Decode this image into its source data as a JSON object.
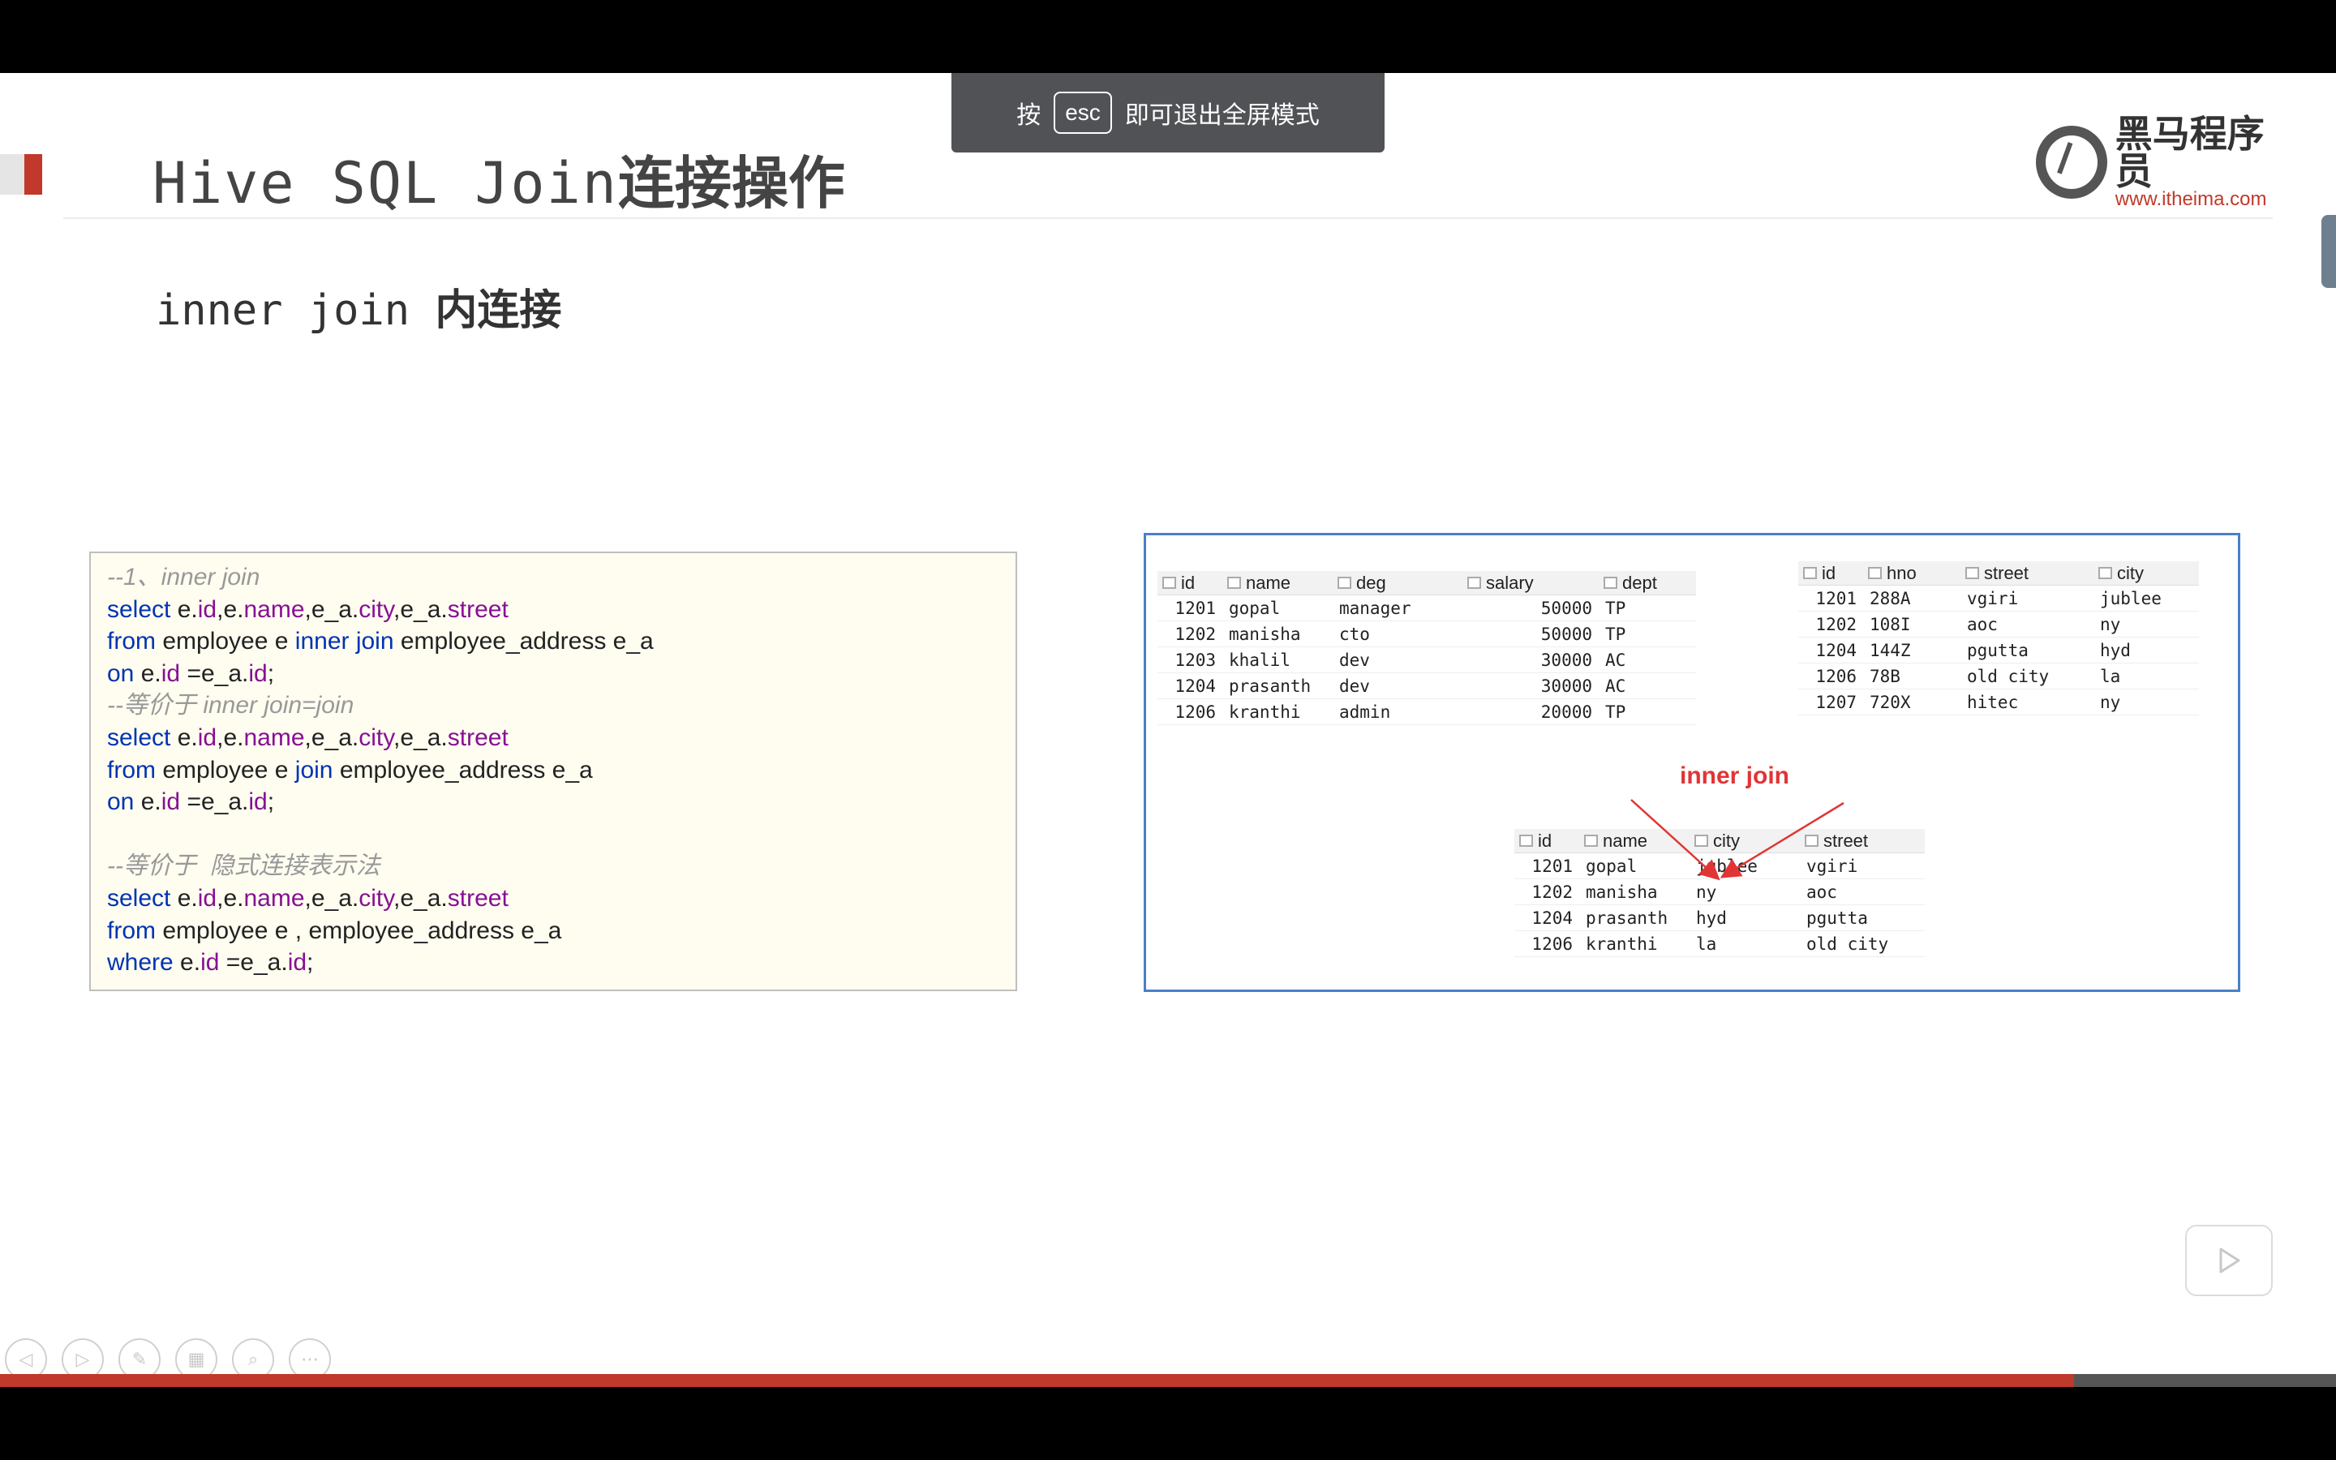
{
  "slide": {
    "title_en": "Hive SQL Join",
    "title_cn": "连接操作",
    "subtitle_en": "inner join ",
    "subtitle_cn": "内连接"
  },
  "toast": {
    "pre": "按",
    "key": "esc",
    "post": "即可退出全屏模式"
  },
  "logo": {
    "cn": "黑马程序员",
    "url": "www.itheima.com"
  },
  "code_lines": [
    [
      {
        "t": "--1、inner join",
        "c": "cm"
      }
    ],
    [
      {
        "t": "select ",
        "c": "kw"
      },
      {
        "t": "e.",
        "c": "tx"
      },
      {
        "t": "id",
        "c": "pr"
      },
      {
        "t": ",e.",
        "c": "tx"
      },
      {
        "t": "name",
        "c": "pr"
      },
      {
        "t": ",e_a.",
        "c": "tx"
      },
      {
        "t": "city",
        "c": "pr"
      },
      {
        "t": ",e_a.",
        "c": "tx"
      },
      {
        "t": "street",
        "c": "pr"
      }
    ],
    [
      {
        "t": "from ",
        "c": "kw"
      },
      {
        "t": "employee e ",
        "c": "tx"
      },
      {
        "t": "inner join ",
        "c": "kw"
      },
      {
        "t": "employee_address e_a",
        "c": "tx"
      }
    ],
    [
      {
        "t": "on ",
        "c": "kw"
      },
      {
        "t": "e.",
        "c": "tx"
      },
      {
        "t": "id",
        "c": "pr"
      },
      {
        "t": " =e_a.",
        "c": "tx"
      },
      {
        "t": "id",
        "c": "pr"
      },
      {
        "t": ";",
        "c": "tx"
      }
    ],
    [
      {
        "t": "--等价于 inner join=join",
        "c": "cm"
      }
    ],
    [
      {
        "t": "select ",
        "c": "kw"
      },
      {
        "t": "e.",
        "c": "tx"
      },
      {
        "t": "id",
        "c": "pr"
      },
      {
        "t": ",e.",
        "c": "tx"
      },
      {
        "t": "name",
        "c": "pr"
      },
      {
        "t": ",e_a.",
        "c": "tx"
      },
      {
        "t": "city",
        "c": "pr"
      },
      {
        "t": ",e_a.",
        "c": "tx"
      },
      {
        "t": "street",
        "c": "pr"
      }
    ],
    [
      {
        "t": "from ",
        "c": "kw"
      },
      {
        "t": "employee e ",
        "c": "tx"
      },
      {
        "t": "join ",
        "c": "kw"
      },
      {
        "t": "employee_address e_a",
        "c": "tx"
      }
    ],
    [
      {
        "t": "on ",
        "c": "kw"
      },
      {
        "t": "e.",
        "c": "tx"
      },
      {
        "t": "id",
        "c": "pr"
      },
      {
        "t": " =e_a.",
        "c": "tx"
      },
      {
        "t": "id",
        "c": "pr"
      },
      {
        "t": ";",
        "c": "tx"
      }
    ],
    [],
    [
      {
        "t": "--等价于  隐式连接表示法",
        "c": "cm"
      }
    ],
    [
      {
        "t": "select ",
        "c": "kw"
      },
      {
        "t": "e.",
        "c": "tx"
      },
      {
        "t": "id",
        "c": "pr"
      },
      {
        "t": ",e.",
        "c": "tx"
      },
      {
        "t": "name",
        "c": "pr"
      },
      {
        "t": ",e_a.",
        "c": "tx"
      },
      {
        "t": "city",
        "c": "pr"
      },
      {
        "t": ",e_a.",
        "c": "tx"
      },
      {
        "t": "street",
        "c": "pr"
      }
    ],
    [
      {
        "t": "from ",
        "c": "kw"
      },
      {
        "t": "employee e , employee_address e_a",
        "c": "tx"
      }
    ],
    [
      {
        "t": "where ",
        "c": "kw"
      },
      {
        "t": "e.",
        "c": "tx"
      },
      {
        "t": "id",
        "c": "pr"
      },
      {
        "t": " =e_a.",
        "c": "tx"
      },
      {
        "t": "id",
        "c": "pr"
      },
      {
        "t": ";",
        "c": "tx"
      }
    ]
  ],
  "diagram": {
    "join_label": "inner join",
    "employee": {
      "headers": [
        "id",
        "name",
        "deg",
        "salary",
        "dept"
      ],
      "rows": [
        [
          "1201",
          "gopal",
          "manager",
          "50000",
          "TP"
        ],
        [
          "1202",
          "manisha",
          "cto",
          "50000",
          "TP"
        ],
        [
          "1203",
          "khalil",
          "dev",
          "30000",
          "AC"
        ],
        [
          "1204",
          "prasanth",
          "dev",
          "30000",
          "AC"
        ],
        [
          "1206",
          "kranthi",
          "admin",
          "20000",
          "TP"
        ]
      ]
    },
    "employee_address": {
      "headers": [
        "id",
        "hno",
        "street",
        "city"
      ],
      "rows": [
        [
          "1201",
          "288A",
          "vgiri",
          "jublee"
        ],
        [
          "1202",
          "108I",
          "aoc",
          "ny"
        ],
        [
          "1204",
          "144Z",
          "pgutta",
          "hyd"
        ],
        [
          "1206",
          "78B",
          "old city",
          "la"
        ],
        [
          "1207",
          "720X",
          "hitec",
          "ny"
        ]
      ]
    },
    "result": {
      "headers": [
        "id",
        "name",
        "city",
        "street"
      ],
      "rows": [
        [
          "1201",
          "gopal",
          "jublee",
          "vgiri"
        ],
        [
          "1202",
          "manisha",
          "ny",
          "aoc"
        ],
        [
          "1204",
          "prasanth",
          "hyd",
          "pgutta"
        ],
        [
          "1206",
          "kranthi",
          "la",
          "old city"
        ]
      ]
    }
  },
  "player": {
    "progress_fraction": 0.888,
    "nav_icons": [
      "prev-icon",
      "next-icon",
      "pen-icon",
      "grid-icon",
      "zoom-icon",
      "more-icon"
    ]
  },
  "colors": {
    "accent_red": "#c0392b",
    "diagram_border": "#4a7fc9",
    "code_bg": "#fefdf0",
    "join_label": "#e03535"
  }
}
